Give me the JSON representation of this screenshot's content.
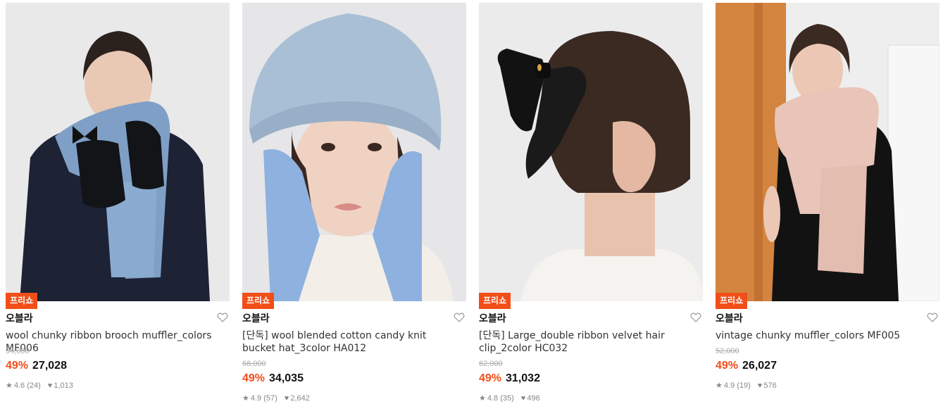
{
  "colors": {
    "accent": "#f14e18"
  },
  "products": [
    {
      "badge": "프리쇼",
      "brand": "오블라",
      "name": "wool chunky ribbon brooch muffler_colors MF006",
      "original_price": "54,000",
      "discount": "49%",
      "price": "27,028",
      "rating": "4.6",
      "reviews": "(24)",
      "likes": "1,013"
    },
    {
      "badge": "프리쇼",
      "brand": "오블라",
      "name": "[단독] wool blended cotton candy knit bucket hat_3color HA012",
      "original_price": "68,000",
      "discount": "49%",
      "price": "34,035",
      "rating": "4.9",
      "reviews": "(57)",
      "likes": "2,642"
    },
    {
      "badge": "프리쇼",
      "brand": "오블라",
      "name": "[단독] Large_double ribbon velvet hair clip_2color HC032",
      "original_price": "62,000",
      "discount": "49%",
      "price": "31,032",
      "rating": "4.8",
      "reviews": "(35)",
      "likes": "496"
    },
    {
      "badge": "프리쇼",
      "brand": "오블라",
      "name": "vintage chunky muffler_colors MF005",
      "original_price": "52,000",
      "discount": "49%",
      "price": "26,027",
      "rating": "4.9",
      "reviews": "(19)",
      "likes": "576"
    }
  ]
}
